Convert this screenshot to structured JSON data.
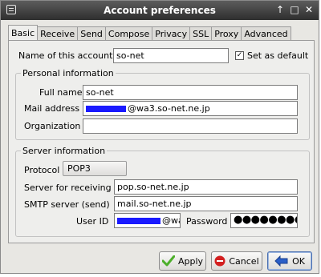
{
  "window": {
    "title": "Account preferences"
  },
  "titlebar_buttons": [
    "↑",
    "□",
    "✕"
  ],
  "tabs": [
    {
      "label": "Basic"
    },
    {
      "label": "Receive"
    },
    {
      "label": "Send"
    },
    {
      "label": "Compose"
    },
    {
      "label": "Privacy"
    },
    {
      "label": "SSL"
    },
    {
      "label": "Proxy"
    },
    {
      "label": "Advanced"
    }
  ],
  "account": {
    "name_label": "Name of this account",
    "name_value": "so-net",
    "default_label": "Set as default",
    "default_checked": true
  },
  "personal": {
    "title": "Personal information",
    "fullname_label": "Full name",
    "fullname_value": "so-net",
    "mail_label": "Mail address",
    "mail_value": "@wa3.so-net.ne.jp",
    "org_label": "Organization",
    "org_value": ""
  },
  "server": {
    "title": "Server information",
    "protocol_label": "Protocol",
    "protocol_value": "POP3",
    "receiving_label": "Server for receiving",
    "receiving_value": "pop.so-net.ne.jp",
    "smtp_label": "SMTP server (send)",
    "smtp_value": "mail.so-net.ne.jp",
    "userid_label": "User ID",
    "userid_value": "@wa",
    "password_label": "Password",
    "password_value": "●●●●●●●●"
  },
  "buttons": {
    "apply": {
      "label": "Apply",
      "icon": "checkmark-icon",
      "color": "#4caf2a"
    },
    "cancel": {
      "label": "Cancel",
      "icon": "cancel-icon",
      "color": "#d32020"
    },
    "ok": {
      "label": "OK",
      "icon": "ok-arrow-icon",
      "color": "#2a5fc8"
    }
  }
}
